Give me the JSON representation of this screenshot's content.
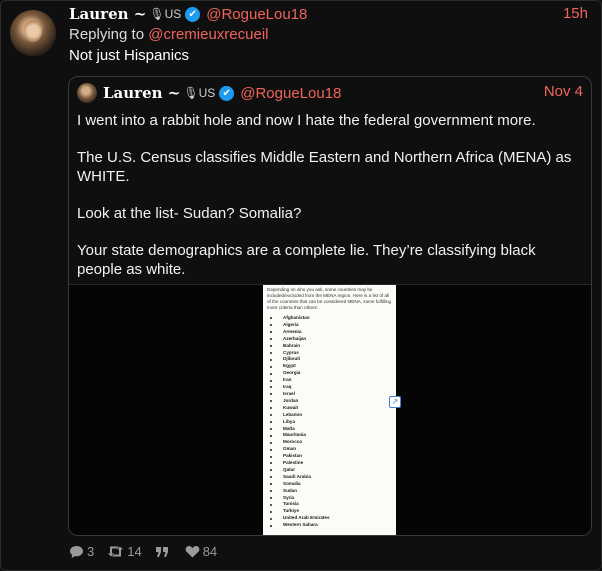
{
  "post": {
    "author_name": "Lauren ~",
    "author_badge": "US",
    "verified_icon": "✔",
    "handle": "@RogueLou18",
    "time": "15h",
    "replying_prefix": "Replying to",
    "replying_to": "@cremieuxrecueil",
    "text": "Not just Hispanics"
  },
  "quote": {
    "author_name": "Lauren ~",
    "author_badge": "US",
    "verified_icon": "✔",
    "handle": "@RogueLou18",
    "date": "Nov 4",
    "paragraphs": [
      "I went into a rabbit hole and now I hate the federal government more.",
      "The U.S. Census classifies Middle Eastern and Northern Africa (MENA) as WHITE.",
      "Look at the list- Sudan? Somalia?",
      "Your state demographics are a complete lie. They’re classifying black people as white."
    ],
    "image": {
      "intro": "Depending on who you ask, some countries may be included/excluded from the MENA region. Here is a list of all of the countries that can be considered MENA, some fulfilling more criteria than others:",
      "countries": [
        "Afghanistan",
        "Algeria",
        "Armenia",
        "Azerbaijan",
        "Bahrain",
        "Cyprus",
        "Djibouti",
        "Egypt",
        "Georgia",
        "Iran",
        "Iraq",
        "Israel",
        "Jordan",
        "Kuwait",
        "Lebanon",
        "Libya",
        "Malta",
        "Mauritania",
        "Morocco",
        "Oman",
        "Pakistan",
        "Palestine",
        "Qatar",
        "Saudi Arabia",
        "Somalia",
        "Sudan",
        "Syria",
        "Tunisia",
        "Turkiye",
        "United Arab Emirates",
        "Western Sahara"
      ]
    }
  },
  "actions": {
    "replies": "3",
    "retweets": "14",
    "likes": "84"
  },
  "colors": {
    "accent": "#f0645a",
    "verified": "#1d9bf0",
    "background": "#0f0f0f"
  }
}
